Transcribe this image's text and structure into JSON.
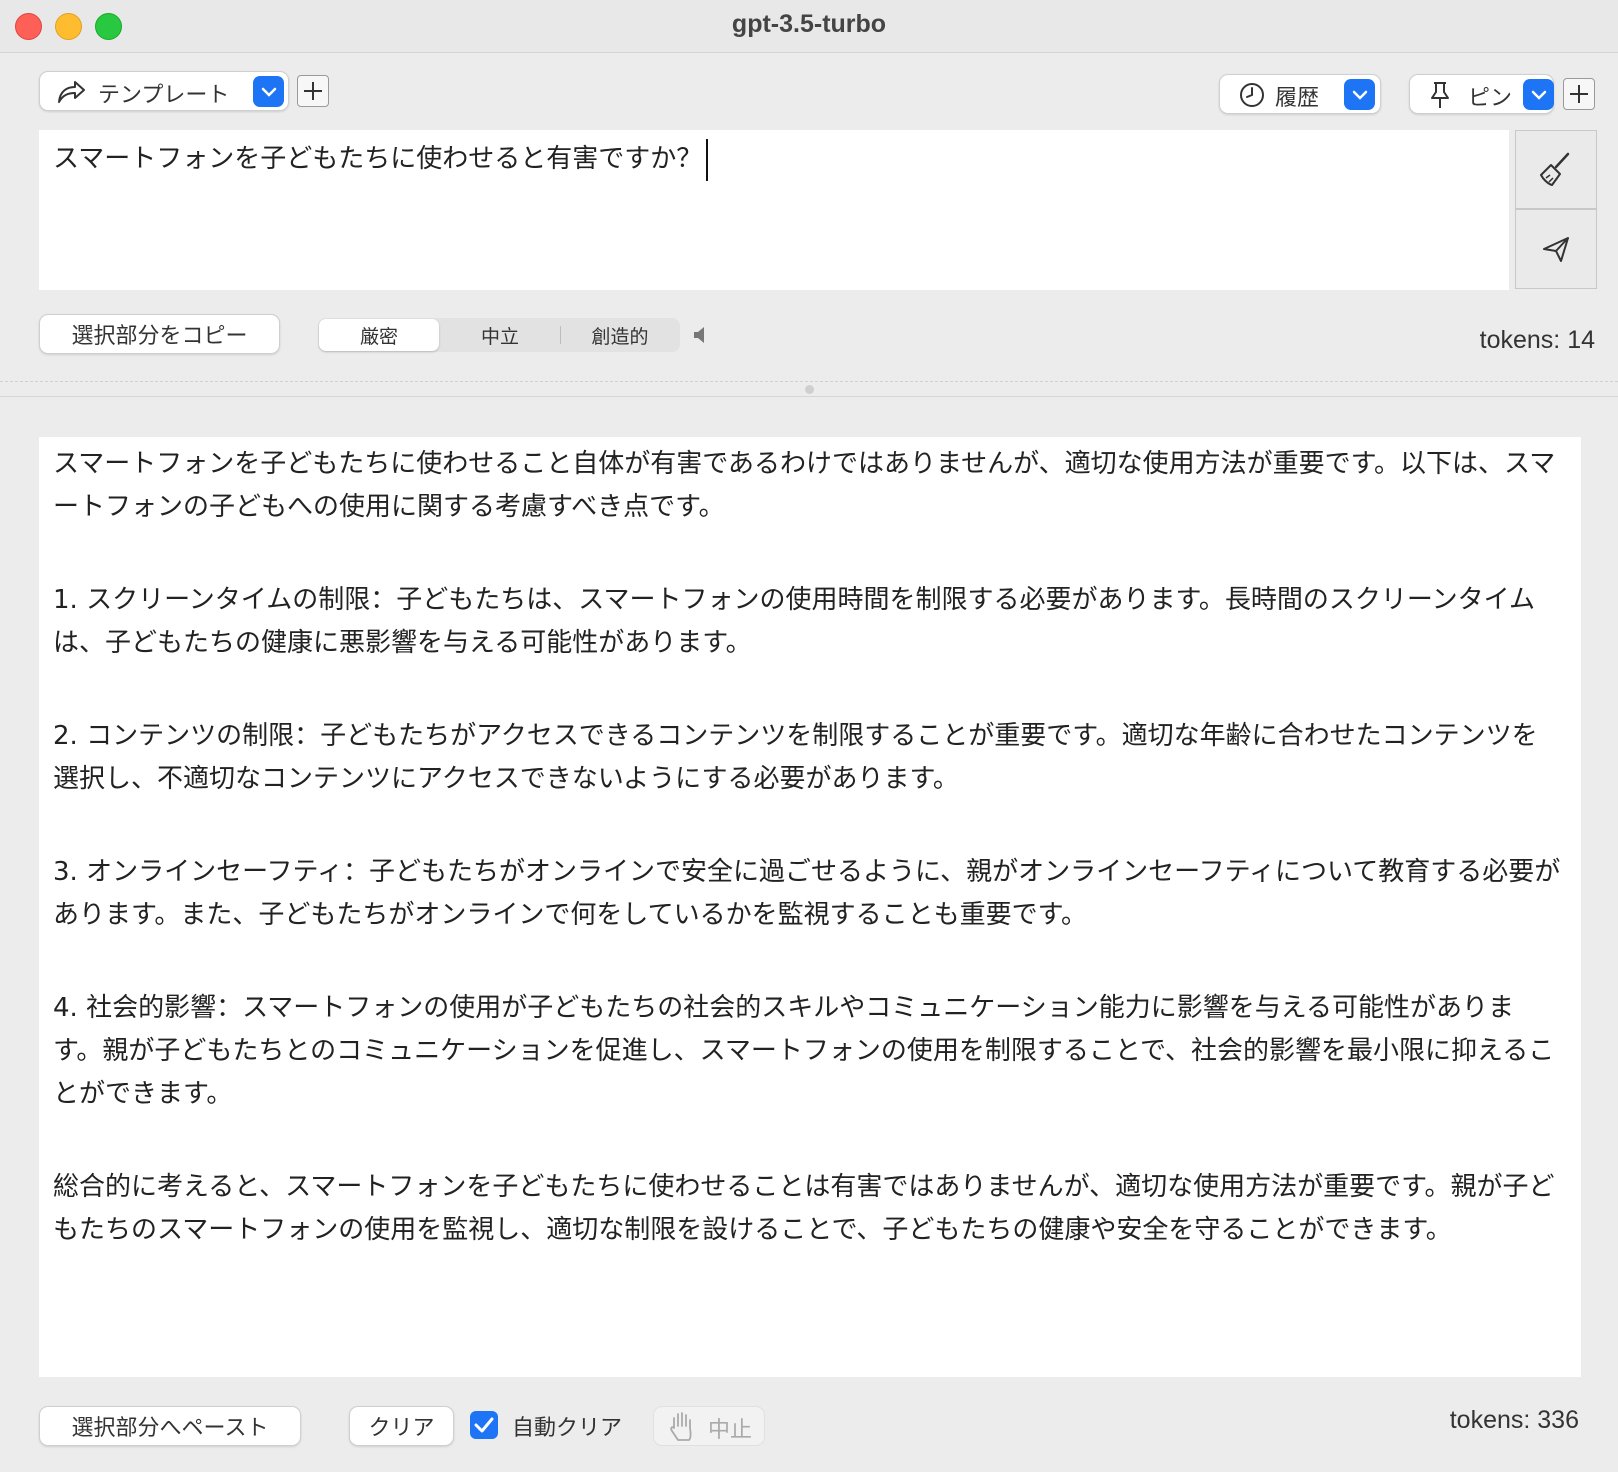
{
  "window": {
    "title": "gpt-3.5-turbo"
  },
  "toolbar": {
    "template_label": "テンプレート",
    "history_label": "履歴",
    "pin_label": "ピン"
  },
  "prompt": {
    "text": "スマートフォンを子どもたちに使わせると有害ですか？"
  },
  "controls": {
    "copy_selection_label": "選択部分をコピー",
    "modes": [
      {
        "label": "厳密",
        "selected": true
      },
      {
        "label": "中立",
        "selected": false
      },
      {
        "label": "創造的",
        "selected": false
      }
    ],
    "prompt_tokens": "tokens: 14"
  },
  "response": {
    "paragraphs": [
      "スマートフォンを子どもたちに使わせること自体が有害であるわけではありませんが、適切な使用方法が重要です。以下は、スマートフォンの子どもへの使用に関する考慮すべき点です。",
      "1. スクリーンタイムの制限：子どもたちは、スマートフォンの使用時間を制限する必要があります。長時間のスクリーンタイムは、子どもたちの健康に悪影響を与える可能性があります。",
      "2. コンテンツの制限：子どもたちがアクセスできるコンテンツを制限することが重要です。適切な年齢に合わせたコンテンツを選択し、不適切なコンテンツにアクセスできないようにする必要があります。",
      "3. オンラインセーフティ：子どもたちがオンラインで安全に過ごせるように、親がオンラインセーフティについて教育する必要があります。また、子どもたちがオンラインで何をしているかを監視することも重要です。",
      "4. 社会的影響：スマートフォンの使用が子どもたちの社会的スキルやコミュニケーション能力に影響を与える可能性があります。親が子どもたちとのコミュニケーションを促進し、スマートフォンの使用を制限することで、社会的影響を最小限に抑えることができます。",
      "総合的に考えると、スマートフォンを子どもたちに使わせることは有害ではありませんが、適切な使用方法が重要です。親が子どもたちのスマートフォンの使用を監視し、適切な制限を設けることで、子どもたちの健康や安全を守ることができます。"
    ]
  },
  "bottom": {
    "paste_selection_label": "選択部分へペースト",
    "clear_label": "クリア",
    "auto_clear_label": "自動クリア",
    "auto_clear_checked": true,
    "stop_label": "中止",
    "response_tokens": "tokens: 336"
  },
  "colors": {
    "accent": "#1d74f5",
    "window_bg": "#ececec"
  },
  "icons": [
    "share-arrow-icon",
    "chevron-down-icon",
    "plus-icon",
    "clock-icon",
    "pin-icon",
    "broom-icon",
    "send-icon",
    "speaker-icon",
    "hand-icon",
    "checkmark-icon"
  ]
}
